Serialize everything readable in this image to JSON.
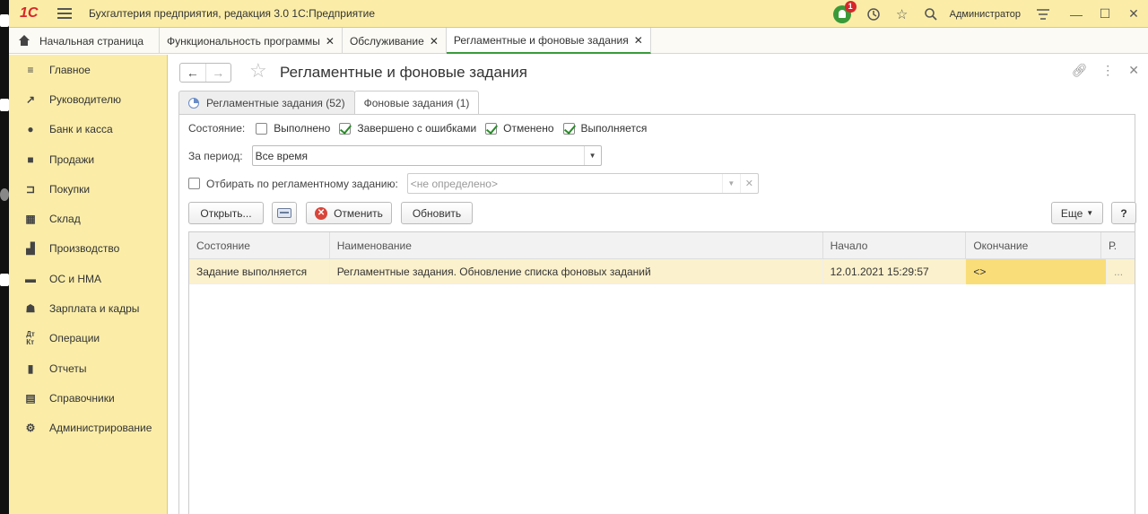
{
  "app": {
    "logo": "1С",
    "title": "Бухгалтерия предприятия, редакция 3.0 1С:Предприятие",
    "notifications_count": "1",
    "user": "Администратор"
  },
  "open_tabs": [
    {
      "label": "Начальная страница"
    },
    {
      "label": "Функциональность программы"
    },
    {
      "label": "Обслуживание"
    },
    {
      "label": "Регламентные и фоновые задания"
    }
  ],
  "sidebar": {
    "items": [
      {
        "label": "Главное",
        "icon": "menu-icon"
      },
      {
        "label": "Руководителю",
        "icon": "trend-icon"
      },
      {
        "label": "Банк и касса",
        "icon": "coin-icon"
      },
      {
        "label": "Продажи",
        "icon": "bag-icon"
      },
      {
        "label": "Покупки",
        "icon": "cart-icon"
      },
      {
        "label": "Склад",
        "icon": "warehouse-icon"
      },
      {
        "label": "Производство",
        "icon": "factory-icon"
      },
      {
        "label": "ОС и НМА",
        "icon": "truck-icon"
      },
      {
        "label": "Зарплата и кадры",
        "icon": "person-icon"
      },
      {
        "label": "Операции",
        "icon": "dt-kt-icon"
      },
      {
        "label": "Отчеты",
        "icon": "bar-chart-icon"
      },
      {
        "label": "Справочники",
        "icon": "books-icon"
      },
      {
        "label": "Администрирование",
        "icon": "gear-icon"
      }
    ]
  },
  "page": {
    "title": "Регламентные и фоновые задания",
    "subtabs": [
      {
        "label": "Регламентные задания (52)"
      },
      {
        "label": "Фоновые задания (1)"
      }
    ]
  },
  "filters": {
    "state_label": "Состояние:",
    "states": [
      {
        "label": "Выполнено",
        "checked": false
      },
      {
        "label": "Завершено с ошибками",
        "checked": true
      },
      {
        "label": "Отменено",
        "checked": true
      },
      {
        "label": "Выполняется",
        "checked": true
      }
    ],
    "period_label": "За период:",
    "period_value": "Все время",
    "by_task_label": "Отбирать по регламентному заданию:",
    "by_task_placeholder": "<не определено>"
  },
  "toolbar": {
    "open": "Открыть...",
    "cancel": "Отменить",
    "refresh": "Обновить",
    "more": "Еще",
    "help": "?"
  },
  "table": {
    "columns": [
      "Состояние",
      "Наименование",
      "Начало",
      "Окончание",
      "Р."
    ],
    "rows": [
      {
        "state": "Задание выполняется",
        "name": "Регламентные задания. Обновление списка фоновых заданий",
        "start": "12.01.2021 15:29:57",
        "end": "<>",
        "r": "..."
      }
    ]
  }
}
